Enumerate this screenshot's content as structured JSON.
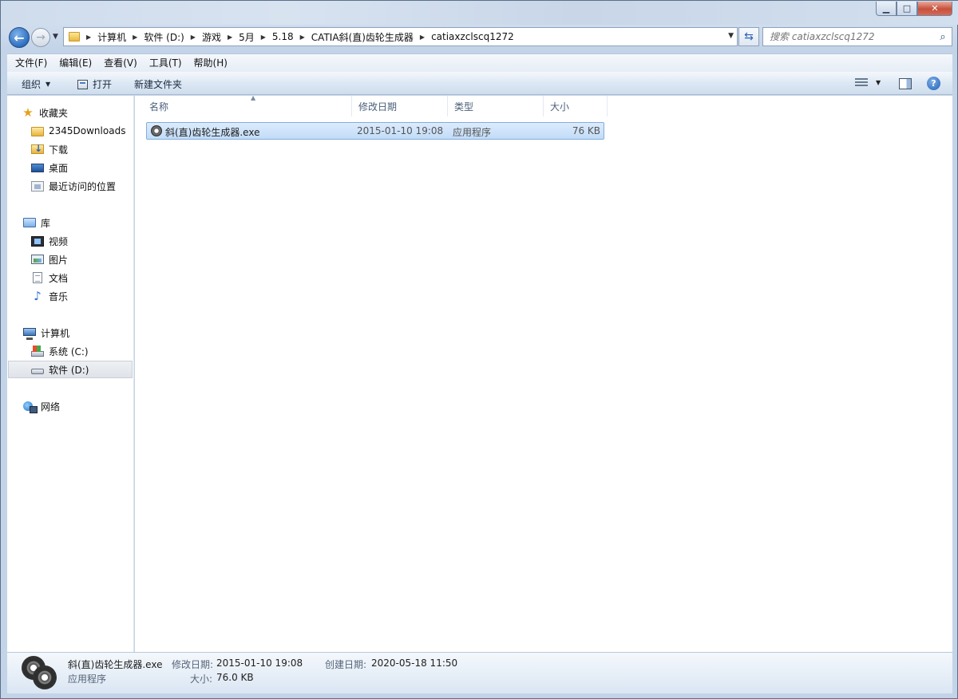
{
  "window": {
    "title_ghost_tabs": [
      "",
      "",
      "",
      "",
      "",
      "",
      "",
      ""
    ],
    "controls": {
      "minimize": "▁",
      "maximize": "□",
      "close": "✕"
    }
  },
  "nav": {
    "back_icon": "←",
    "forward_icon": "→",
    "breadcrumbs": [
      "计算机",
      "软件 (D:)",
      "游戏",
      "5月",
      "5.18",
      "CATIA斜(直)齿轮生成器",
      "catiaxzclscq1272"
    ],
    "search_placeholder": "搜索 catiaxzclscq1272"
  },
  "menu": [
    "文件(F)",
    "编辑(E)",
    "查看(V)",
    "工具(T)",
    "帮助(H)"
  ],
  "commands": {
    "organize": "组织",
    "open": "打开",
    "new_folder": "新建文件夹"
  },
  "sidebar": {
    "favorites": "收藏夹",
    "favorites_items": [
      "2345Downloads",
      "下载",
      "桌面",
      "最近访问的位置"
    ],
    "libraries": "库",
    "library_items": [
      "视频",
      "图片",
      "文档",
      "音乐"
    ],
    "computer": "计算机",
    "computer_items": [
      "系统 (C:)",
      "软件 (D:)"
    ],
    "network": "网络"
  },
  "columns": {
    "name": "名称",
    "modified": "修改日期",
    "type": "类型",
    "size": "大小"
  },
  "files": [
    {
      "name": "斜(直)齿轮生成器.exe",
      "modified": "2015-01-10 19:08",
      "type": "应用程序",
      "size": "76 KB"
    }
  ],
  "details": {
    "filename": "斜(直)齿轮生成器.exe",
    "type": "应用程序",
    "modified_label": "修改日期:",
    "modified_value": "2015-01-10 19:08",
    "size_label": "大小:",
    "size_value": "76.0 KB",
    "created_label": "创建日期:",
    "created_value": "2020-05-18 11:50"
  },
  "colors": {
    "selection": "#c2dcf8",
    "accent": "#2e6fc2"
  }
}
